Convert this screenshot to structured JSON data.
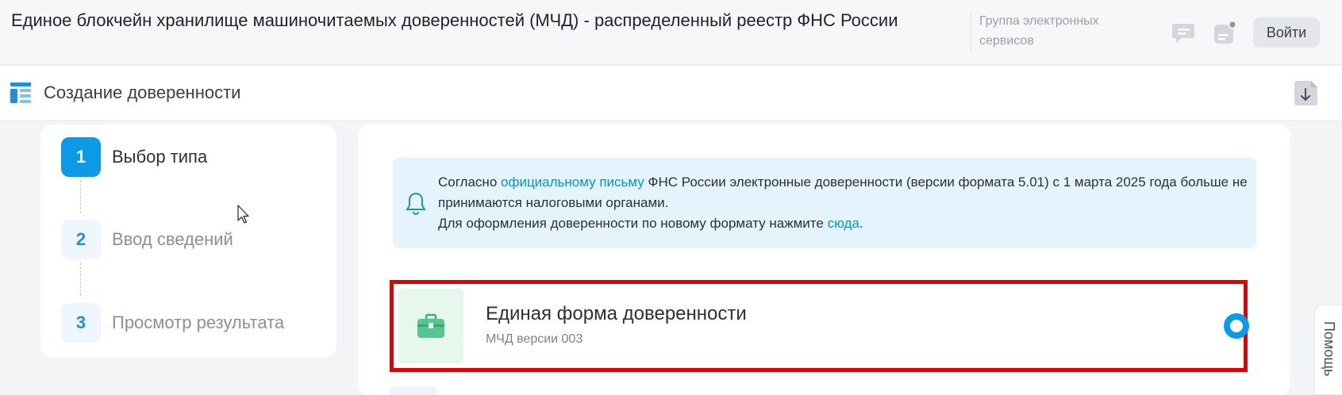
{
  "header": {
    "title": "Единое блокчейн хранилище машиночитаемых доверенностей (МЧД) - распределенный реестр ФНС России",
    "group_link": "Группа электронных сервисов",
    "chat_icon": "chat-icon",
    "notification_icon": "notification-icon",
    "login_label": "Войти"
  },
  "subheader": {
    "title": "Создание доверенности",
    "menu_icon": "layout-menu-icon",
    "download_icon": "download-doc-icon"
  },
  "steps": [
    {
      "number": "1",
      "label": "Выбор типа",
      "active": true
    },
    {
      "number": "2",
      "label": "Ввод сведений",
      "active": false
    },
    {
      "number": "3",
      "label": "Просмотр результата",
      "active": false
    }
  ],
  "notice": {
    "icon": "bell-icon",
    "line1_before": "Согласно ",
    "line1_link": "официальному письму",
    "line1_after": " ФНС России электронные доверенности (версии формата 5.01) с 1 марта 2025 года больше не принимаются налоговыми органами.",
    "line2_before": "Для оформления доверенности по новому формату нажмите ",
    "line2_link": "сюда",
    "line2_after": "."
  },
  "option": {
    "icon": "briefcase-icon",
    "title": "Единая форма доверенности",
    "subtitle": "МЧД версии 003",
    "selected": true
  },
  "help_tab": "Помощь",
  "colors": {
    "accent": "#0a9ae6",
    "highlight_border": "#e00000",
    "notice_bg": "#e5f4fc"
  }
}
